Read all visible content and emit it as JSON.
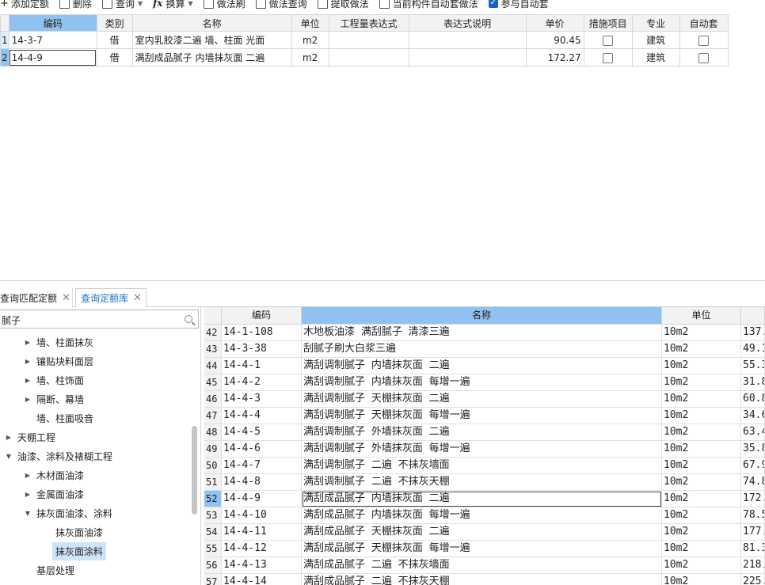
{
  "toolbar": {
    "add_quota": "添加定额",
    "delete": "删除",
    "query": "查询",
    "convert": "换算",
    "method_brush": "做法刷",
    "method_query": "做法查询",
    "extract_method": "提取做法",
    "auto_method": "当前构件自动套做法",
    "join_auto": "参与自动套"
  },
  "upper_table": {
    "headers": [
      "编码",
      "类别",
      "名称",
      "单位",
      "工程量表达式",
      "表达式说明",
      "单价",
      "措施项目",
      "专业",
      "自动套"
    ],
    "rows": [
      {
        "no": "1",
        "code": "14-3-7",
        "category": "借",
        "name": "室内乳胶漆二遍 墙、柱面 光面",
        "unit": "m2",
        "expr": "",
        "expr_desc": "",
        "price": "90.45",
        "measure": false,
        "major": "建筑",
        "auto": false
      },
      {
        "no": "2",
        "code": "14-4-9",
        "category": "借",
        "name": "满刮成品腻子 内墙抹灰面 二遍",
        "unit": "m2",
        "expr": "",
        "expr_desc": "",
        "price": "172.27",
        "measure": false,
        "major": "建筑",
        "auto": false
      }
    ]
  },
  "tabs": [
    {
      "label": "查询匹配定额",
      "active": false
    },
    {
      "label": "查询定额库",
      "active": true
    }
  ],
  "search": {
    "value": "腻子"
  },
  "tree": [
    {
      "label": "墙、柱面抹灰",
      "indent": 1,
      "arrow": "right"
    },
    {
      "label": "镶贴块料面层",
      "indent": 1,
      "arrow": "right"
    },
    {
      "label": "墙、柱饰面",
      "indent": 1,
      "arrow": "right"
    },
    {
      "label": "隔断、幕墙",
      "indent": 1,
      "arrow": "right"
    },
    {
      "label": "墙、柱面吸音",
      "indent": 1,
      "arrow": "none"
    },
    {
      "label": "天棚工程",
      "indent": 0,
      "arrow": "right"
    },
    {
      "label": "油漆、涂料及裱糊工程",
      "indent": 0,
      "arrow": "down"
    },
    {
      "label": "木材面油漆",
      "indent": 1,
      "arrow": "right"
    },
    {
      "label": "金属面油漆",
      "indent": 1,
      "arrow": "right"
    },
    {
      "label": "抹灰面油漆、涂料",
      "indent": 1,
      "arrow": "down"
    },
    {
      "label": "抹灰面油漆",
      "indent": 2,
      "arrow": "none"
    },
    {
      "label": "抹灰面涂料",
      "indent": 2,
      "arrow": "none",
      "selected": true
    },
    {
      "label": "基层处理",
      "indent": 1,
      "arrow": "none"
    }
  ],
  "lower_table": {
    "headers": [
      "",
      "编码",
      "名称",
      "单位",
      ""
    ],
    "rows": [
      {
        "no": "42",
        "code": "14-1-108",
        "name": "木地板油漆 满刮腻子 清漆三遍",
        "unit": "10m2",
        "price": "137."
      },
      {
        "no": "43",
        "code": "14-3-38",
        "name": "刮腻子刷大白浆三遍",
        "unit": "10m2",
        "price": "49.1"
      },
      {
        "no": "44",
        "code": "14-4-1",
        "name": "满刮调制腻子 内墙抹灰面 二遍",
        "unit": "10m2",
        "price": "55.3"
      },
      {
        "no": "45",
        "code": "14-4-2",
        "name": "满刮调制腻子 内墙抹灰面 每增一遍",
        "unit": "10m2",
        "price": "31.8"
      },
      {
        "no": "46",
        "code": "14-4-3",
        "name": "满刮调制腻子 天棚抹灰面 二遍",
        "unit": "10m2",
        "price": "60.8"
      },
      {
        "no": "47",
        "code": "14-4-4",
        "name": "满刮调制腻子 天棚抹灰面 每增一遍",
        "unit": "10m2",
        "price": "34.6"
      },
      {
        "no": "48",
        "code": "14-4-5",
        "name": "满刮调制腻子 外墙抹灰面 二遍",
        "unit": "10m2",
        "price": "63.4"
      },
      {
        "no": "49",
        "code": "14-4-6",
        "name": "满刮调制腻子 外墙抹灰面 每增一遍",
        "unit": "10m2",
        "price": "35.8"
      },
      {
        "no": "50",
        "code": "14-4-7",
        "name": "满刮调制腻子 二遍 不抹灰墙面",
        "unit": "10m2",
        "price": "67.9"
      },
      {
        "no": "51",
        "code": "14-4-8",
        "name": "满刮调制腻子 二遍 不抹灰天棚",
        "unit": "10m2",
        "price": "74.8"
      },
      {
        "no": "52",
        "code": "14-4-9",
        "name": "满刮成品腻子 内墙抹灰面 二遍",
        "unit": "10m2",
        "price": "172.",
        "current": true
      },
      {
        "no": "53",
        "code": "14-4-10",
        "name": "满刮成品腻子 内墙抹灰面 每增一遍",
        "unit": "10m2",
        "price": "78.5"
      },
      {
        "no": "54",
        "code": "14-4-11",
        "name": "满刮成品腻子 天棚抹灰面 二遍",
        "unit": "10m2",
        "price": "177."
      },
      {
        "no": "55",
        "code": "14-4-12",
        "name": "满刮成品腻子 天棚抹灰面 每增一遍",
        "unit": "10m2",
        "price": "81.3"
      },
      {
        "no": "56",
        "code": "14-4-13",
        "name": "满刮成品腻子 二遍 不抹灰墙面",
        "unit": "10m2",
        "price": "218."
      },
      {
        "no": "57",
        "code": "14-4-14",
        "name": "满刮成品腻子 二遍 不抹灰天棚",
        "unit": "10m2",
        "price": "225."
      }
    ]
  }
}
